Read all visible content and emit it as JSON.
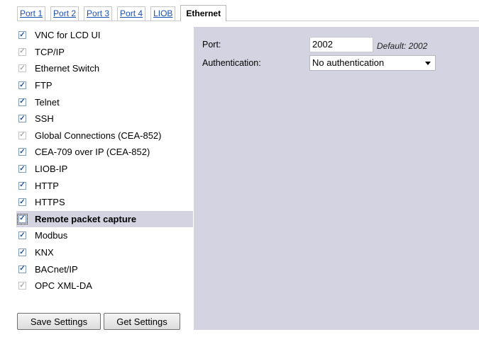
{
  "tabs": [
    {
      "label": "Port 1",
      "active": false
    },
    {
      "label": "Port 2",
      "active": false
    },
    {
      "label": "Port 3",
      "active": false
    },
    {
      "label": "Port 4",
      "active": false
    },
    {
      "label": "LIOB",
      "active": false
    },
    {
      "label": "Ethernet",
      "active": true
    }
  ],
  "services": [
    {
      "label": "VNC for LCD UI",
      "checked": true,
      "disabled": false
    },
    {
      "label": "TCP/IP",
      "checked": true,
      "disabled": true
    },
    {
      "label": "Ethernet Switch",
      "checked": true,
      "disabled": true
    },
    {
      "label": "FTP",
      "checked": true,
      "disabled": false
    },
    {
      "label": "Telnet",
      "checked": true,
      "disabled": false
    },
    {
      "label": "SSH",
      "checked": true,
      "disabled": false
    },
    {
      "label": "Global Connections (CEA-852)",
      "checked": true,
      "disabled": true
    },
    {
      "label": "CEA-709 over IP (CEA-852)",
      "checked": true,
      "disabled": false
    },
    {
      "label": "LIOB-IP",
      "checked": true,
      "disabled": false
    },
    {
      "label": "HTTP",
      "checked": true,
      "disabled": false
    },
    {
      "label": "HTTPS",
      "checked": true,
      "disabled": false
    },
    {
      "label": "Remote packet capture",
      "checked": true,
      "disabled": false,
      "selected": true
    },
    {
      "label": "Modbus",
      "checked": true,
      "disabled": false
    },
    {
      "label": "KNX",
      "checked": true,
      "disabled": false
    },
    {
      "label": "BACnet/IP",
      "checked": true,
      "disabled": false
    },
    {
      "label": "OPC XML-DA",
      "checked": true,
      "disabled": true
    }
  ],
  "buttons": {
    "save": "Save Settings",
    "get": "Get Settings"
  },
  "settings": {
    "port_label": "Port:",
    "port_value": "2002",
    "port_default": "Default: 2002",
    "auth_label": "Authentication:",
    "auth_value": "No authentication"
  },
  "colors": {
    "panel_bg": "#d3d3e2",
    "link": "#1a4fb3"
  }
}
